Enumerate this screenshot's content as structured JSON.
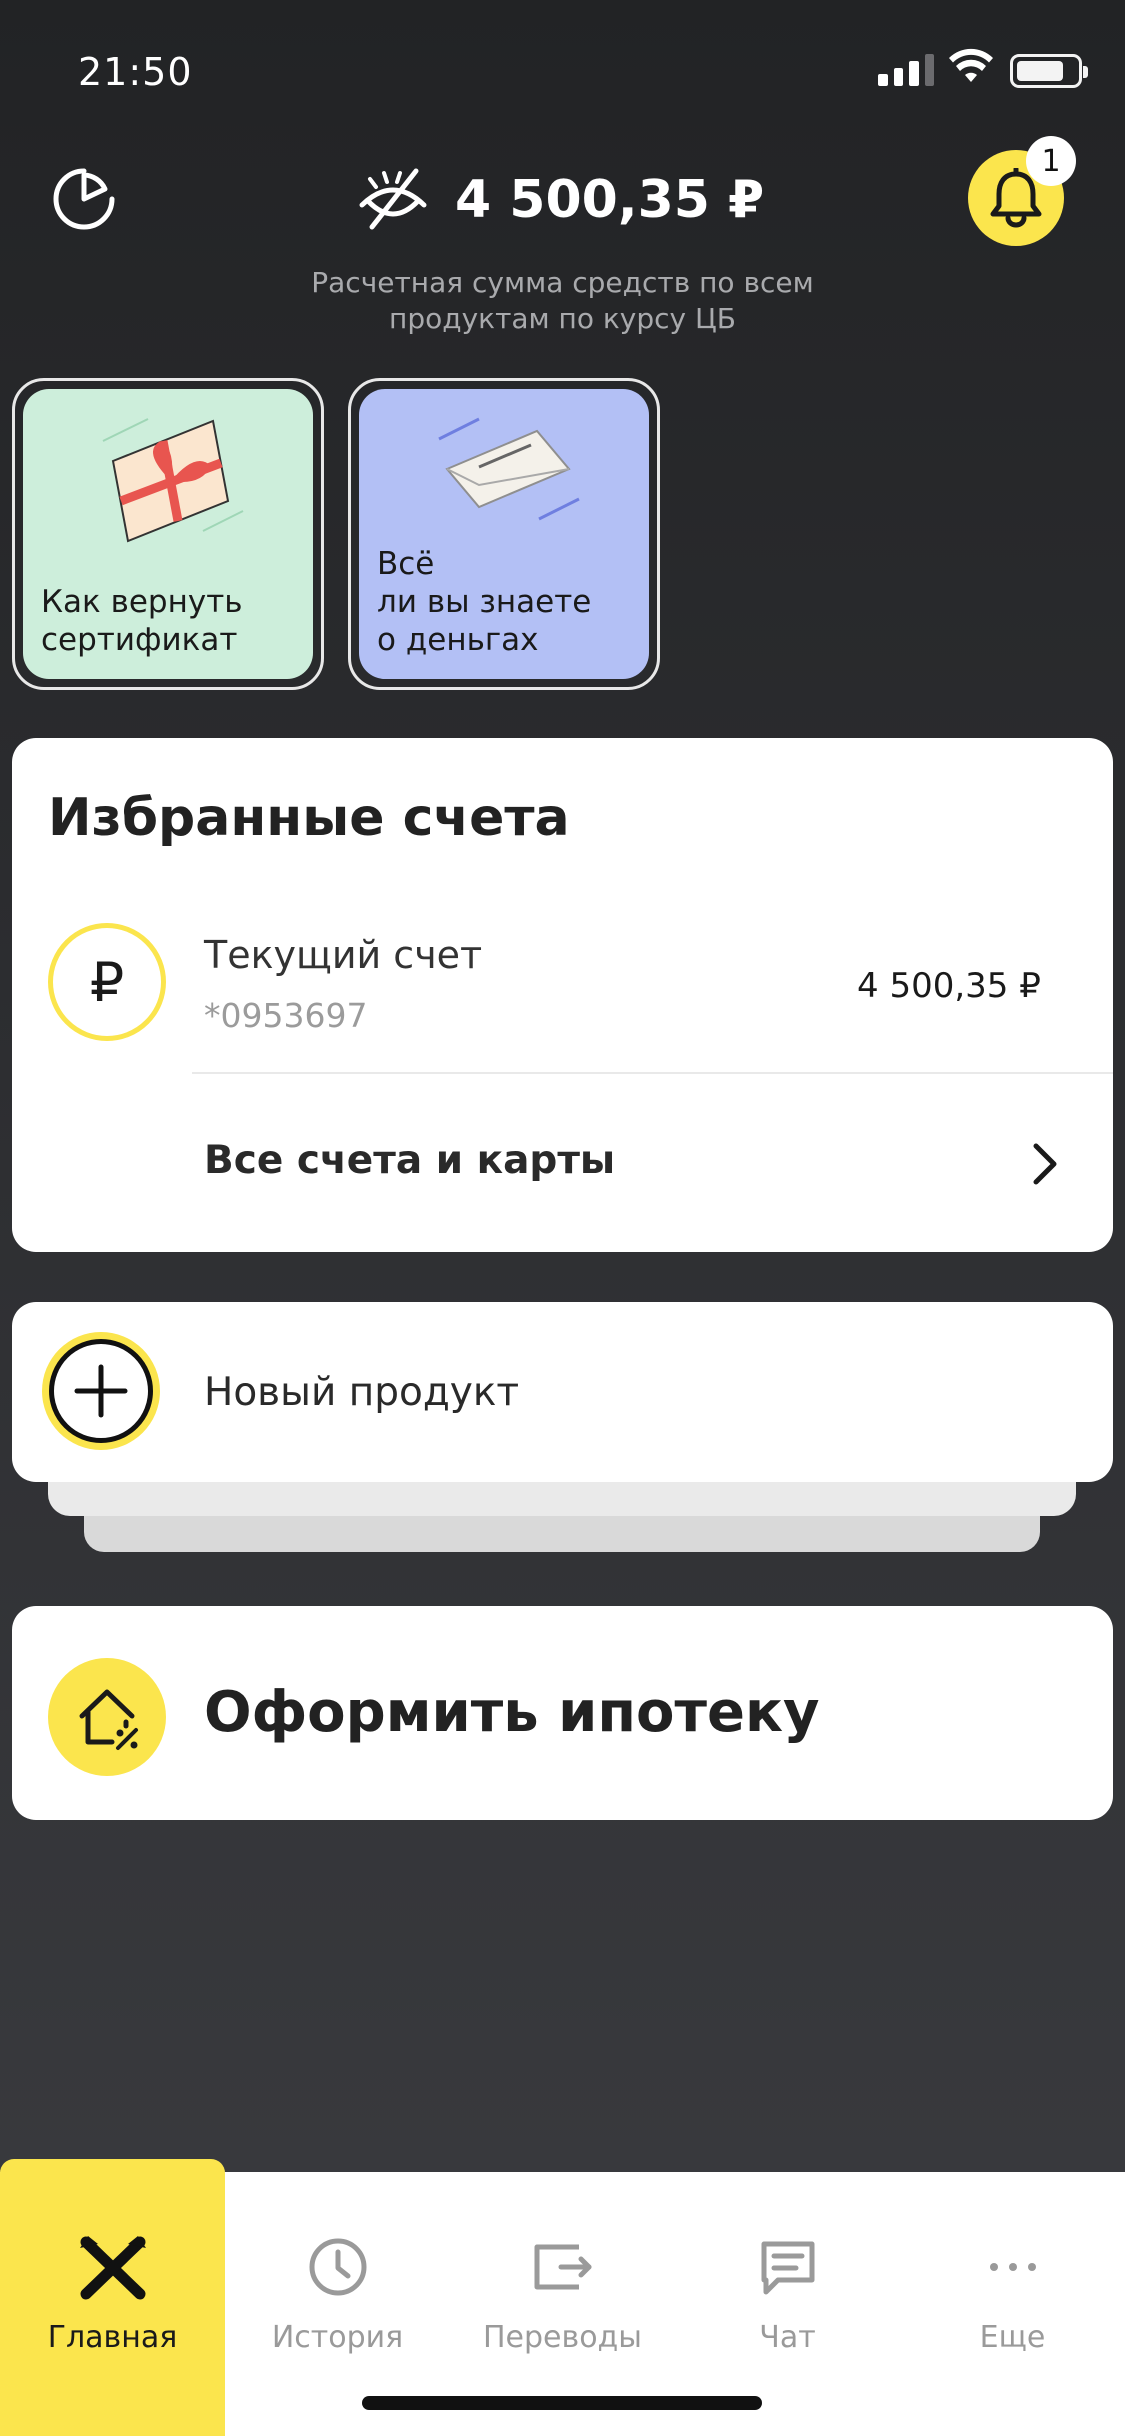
{
  "status_bar": {
    "time": "21:50"
  },
  "header": {
    "balance": "4 500,35 ₽",
    "notifications_count": "1",
    "subtitle": "Расчетная сумма средств по всем продуктам по курсу ЦБ"
  },
  "stories": [
    {
      "label": "Как вернуть\nсертификат",
      "color": "#cdeedb"
    },
    {
      "label": "Всё\nли вы знаете\nо деньгах",
      "color": "#b3c0f5"
    }
  ],
  "favorites": {
    "title": "Избранные счета",
    "accounts": [
      {
        "name": "Текущий счет",
        "number": "*0953697",
        "amount": "4 500,35 ₽",
        "currency_symbol": "₽"
      }
    ],
    "all_accounts_label": "Все счета и карты"
  },
  "new_product": {
    "label": "Новый продукт"
  },
  "mortgage": {
    "label": "Оформить ипотеку"
  },
  "tabbar": {
    "tabs": [
      {
        "label": "Главная",
        "icon": "raiffeisen-logo-icon",
        "active": true
      },
      {
        "label": "История",
        "icon": "clock-icon"
      },
      {
        "label": "Переводы",
        "icon": "transfer-icon"
      },
      {
        "label": "Чат",
        "icon": "chat-icon"
      },
      {
        "label": "Еще",
        "icon": "more-icon"
      }
    ]
  },
  "colors": {
    "accent": "#fbe54d",
    "background": "#2b2c2f"
  }
}
